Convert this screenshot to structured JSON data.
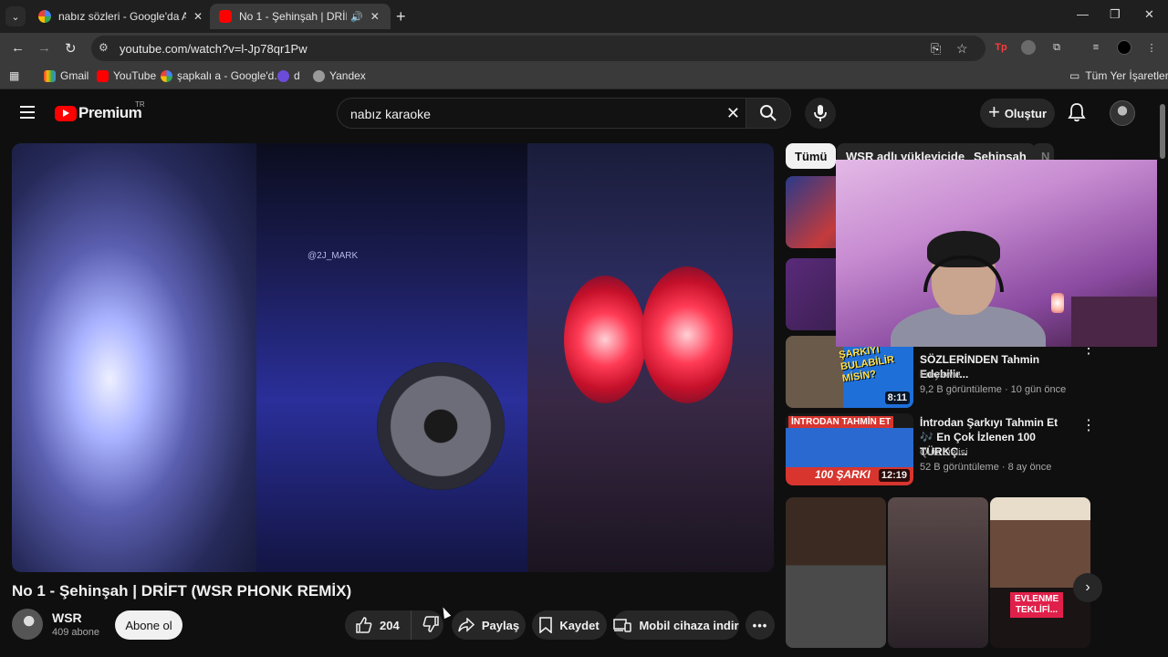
{
  "browser": {
    "tabs": [
      {
        "title": "nabız sözleri - Google'da Ara",
        "favicon": "google-icon",
        "active": false
      },
      {
        "title": "No 1 - Şehinşah | DRİFT (W…",
        "favicon": "youtube-icon",
        "active": true
      }
    ],
    "url": "youtube.com/watch?v=l-Jp78qr1Pw",
    "bookmarks": [
      {
        "label": "Gmail",
        "icon": "gmail-icon"
      },
      {
        "label": "YouTube",
        "icon": "youtube-icon"
      },
      {
        "label": "şapkalı a - Google'd...",
        "icon": "google-icon"
      },
      {
        "label": "d",
        "icon": "d-icon"
      },
      {
        "label": "Yandex",
        "icon": "globe-icon"
      }
    ],
    "all_bookmarks": "Tüm Yer İşaretleri"
  },
  "youtube": {
    "logo_text": "Premium",
    "region": "TR",
    "search_query": "nabız karaoke",
    "create_label": "Oluştur"
  },
  "video": {
    "title": "No 1 - Şehinşah | DRİFT (WSR PHONK REMİX)",
    "watermark": "@2J_MARK",
    "channel_name": "WSR",
    "subscribers": "409 abone",
    "subscribe_label": "Abone ol",
    "likes": "204",
    "share_label": "Paylaş",
    "save_label": "Kaydet",
    "download_label": "Mobil cihaza indir"
  },
  "chips": [
    "Tümü",
    "WSR adlı yükleyiciden",
    "Şehinşah",
    "N"
  ],
  "recommendations": [
    {
      "title": "SÖZLERİNDEN Tahmin Edebilir...",
      "channel": "Freyawie",
      "views": "9,2 B görüntüleme",
      "age": "10 gün önce",
      "duration": "8:11",
      "thumb_text": "ŞARKIYI BULABİLİR MİSİN?"
    },
    {
      "title_line1": "İntrodan Şarkıyı Tahmin Et",
      "title_line2": "🎶 En Çok İzlenen 100 TÜRKÇ...",
      "channel": "Quiz Delisi",
      "views": "52 B görüntüleme",
      "age": "8 ay önce",
      "duration": "12:19",
      "thumb_text_top": "İNTRODAN TAHMİN ET",
      "thumb_text_bottom": "100 ŞARKI"
    }
  ],
  "shorts": [
    {
      "caption": ""
    },
    {
      "caption": ""
    },
    {
      "caption": "EVLENME TEKLİFİ..."
    }
  ],
  "colors": {
    "background": "#0f0f0f",
    "accent": "#ff0000",
    "chip_bg": "#272727"
  }
}
